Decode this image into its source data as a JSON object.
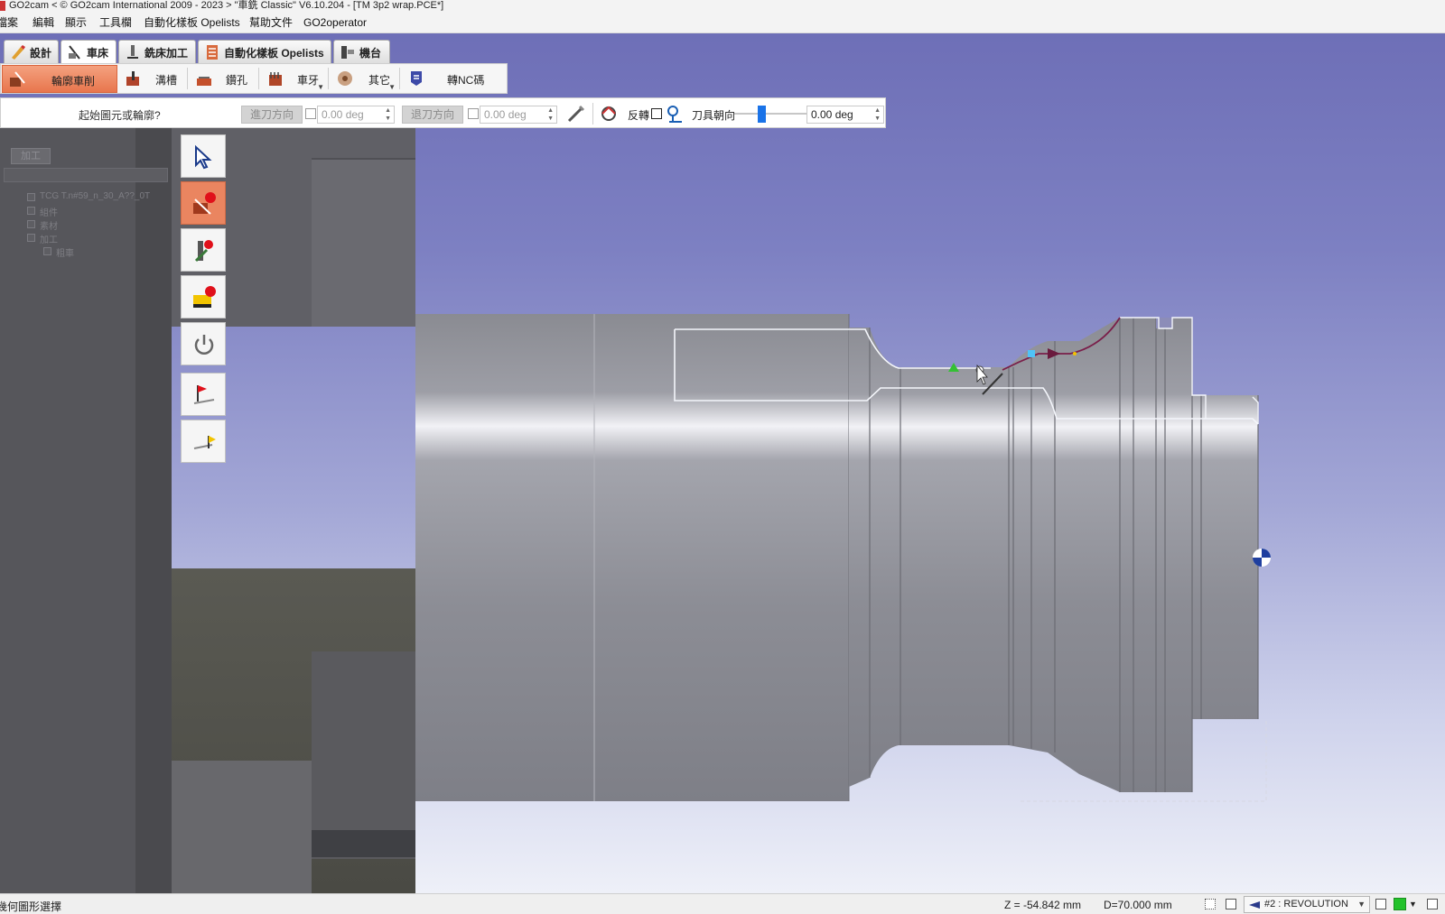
{
  "window": {
    "title": "GO2cam < © GO2cam International 2009 - 2023 >     \"車銑 Classic\"  V6.10.204 - [TM 3p2 wrap.PCE*]"
  },
  "menu": {
    "items": [
      "檔案",
      "編輯",
      "顯示",
      "工具欄",
      "自動化樣板 Opelists",
      "幫助文件",
      "GO2operator"
    ]
  },
  "module_tabs": [
    {
      "label": "設計",
      "active": false,
      "icon": "design-icon"
    },
    {
      "label": "車床",
      "active": true,
      "icon": "lathe-icon"
    },
    {
      "label": "銑床加工",
      "active": false,
      "icon": "milling-icon"
    },
    {
      "label": "自動化樣板 Opelists",
      "active": false,
      "icon": "opelists-icon"
    },
    {
      "label": "機台",
      "active": false,
      "icon": "machine-icon"
    }
  ],
  "ribbon": {
    "items": [
      {
        "label": "輪廓車削",
        "active": true,
        "icon": "contour-turning-icon"
      },
      {
        "label": "溝槽",
        "active": false,
        "icon": "grooving-icon"
      },
      {
        "label": "鑽孔",
        "active": false,
        "icon": "drilling-icon"
      },
      {
        "label": "車牙",
        "active": false,
        "icon": "threading-icon",
        "dropdown": true
      },
      {
        "label": "其它",
        "active": false,
        "icon": "other-icon",
        "dropdown": true
      },
      {
        "label": "轉NC碼",
        "active": false,
        "icon": "nc-code-icon"
      }
    ]
  },
  "prompt_bar": {
    "prompt": "起始圖元或輪廓?",
    "entry_direction": {
      "label": "進刀方向",
      "value": "0.00 deg",
      "enabled": false
    },
    "exit_direction": {
      "label": "退刀方向",
      "value": "0.00 deg",
      "enabled": false
    },
    "reverse_label": "反轉",
    "tool_orientation_label": "刀具朝向",
    "tool_orientation_value": "0.00 deg",
    "slider_level": 0.38
  },
  "tree_panel": {
    "tab": "加工",
    "lines": [
      "TCG T.n#59_n_30_A??_0T",
      "組件",
      "素材",
      "加工",
      "粗車"
    ]
  },
  "side_toolbar": {
    "buttons": [
      {
        "name": "select-pointer",
        "active": false
      },
      {
        "name": "start-point",
        "active": true
      },
      {
        "name": "tool-point",
        "active": false
      },
      {
        "name": "stock-point",
        "active": false
      },
      {
        "name": "power-off",
        "active": false
      },
      {
        "name": "red-flag",
        "active": false
      },
      {
        "name": "yellow-flag",
        "active": false
      }
    ]
  },
  "status_bar": {
    "left_text": "幾何圖形選擇",
    "z_readout": "Z = -54.842 mm",
    "d_readout": "D=70.000 mm",
    "view_mode": "#2 : REVOLUTION"
  },
  "colors": {
    "viewport_top": "#6e6fb7",
    "viewport_bottom": "#eef0f8",
    "active_accent": "#e8764d",
    "toolpath": "#7a1f4a",
    "indicator_green": "#22c22a"
  }
}
